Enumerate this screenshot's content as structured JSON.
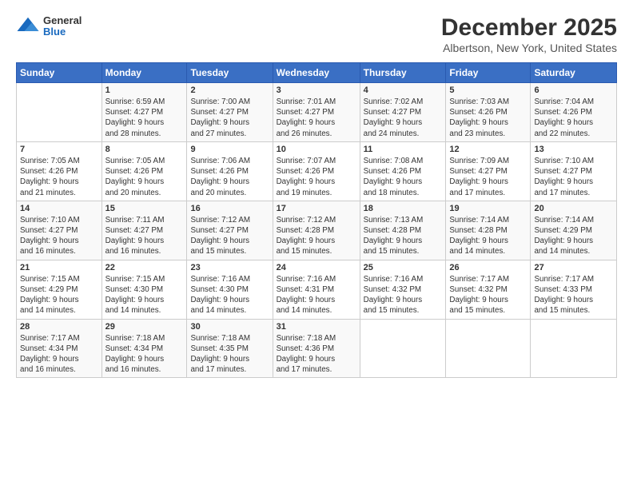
{
  "logo": {
    "general": "General",
    "blue": "Blue"
  },
  "header": {
    "title": "December 2025",
    "subtitle": "Albertson, New York, United States"
  },
  "calendar": {
    "days_of_week": [
      "Sunday",
      "Monday",
      "Tuesday",
      "Wednesday",
      "Thursday",
      "Friday",
      "Saturday"
    ],
    "weeks": [
      [
        {
          "day": "",
          "detail": ""
        },
        {
          "day": "1",
          "detail": "Sunrise: 6:59 AM\nSunset: 4:27 PM\nDaylight: 9 hours\nand 28 minutes."
        },
        {
          "day": "2",
          "detail": "Sunrise: 7:00 AM\nSunset: 4:27 PM\nDaylight: 9 hours\nand 27 minutes."
        },
        {
          "day": "3",
          "detail": "Sunrise: 7:01 AM\nSunset: 4:27 PM\nDaylight: 9 hours\nand 26 minutes."
        },
        {
          "day": "4",
          "detail": "Sunrise: 7:02 AM\nSunset: 4:27 PM\nDaylight: 9 hours\nand 24 minutes."
        },
        {
          "day": "5",
          "detail": "Sunrise: 7:03 AM\nSunset: 4:26 PM\nDaylight: 9 hours\nand 23 minutes."
        },
        {
          "day": "6",
          "detail": "Sunrise: 7:04 AM\nSunset: 4:26 PM\nDaylight: 9 hours\nand 22 minutes."
        }
      ],
      [
        {
          "day": "7",
          "detail": "Sunrise: 7:05 AM\nSunset: 4:26 PM\nDaylight: 9 hours\nand 21 minutes."
        },
        {
          "day": "8",
          "detail": "Sunrise: 7:05 AM\nSunset: 4:26 PM\nDaylight: 9 hours\nand 20 minutes."
        },
        {
          "day": "9",
          "detail": "Sunrise: 7:06 AM\nSunset: 4:26 PM\nDaylight: 9 hours\nand 20 minutes."
        },
        {
          "day": "10",
          "detail": "Sunrise: 7:07 AM\nSunset: 4:26 PM\nDaylight: 9 hours\nand 19 minutes."
        },
        {
          "day": "11",
          "detail": "Sunrise: 7:08 AM\nSunset: 4:26 PM\nDaylight: 9 hours\nand 18 minutes."
        },
        {
          "day": "12",
          "detail": "Sunrise: 7:09 AM\nSunset: 4:27 PM\nDaylight: 9 hours\nand 17 minutes."
        },
        {
          "day": "13",
          "detail": "Sunrise: 7:10 AM\nSunset: 4:27 PM\nDaylight: 9 hours\nand 17 minutes."
        }
      ],
      [
        {
          "day": "14",
          "detail": "Sunrise: 7:10 AM\nSunset: 4:27 PM\nDaylight: 9 hours\nand 16 minutes."
        },
        {
          "day": "15",
          "detail": "Sunrise: 7:11 AM\nSunset: 4:27 PM\nDaylight: 9 hours\nand 16 minutes."
        },
        {
          "day": "16",
          "detail": "Sunrise: 7:12 AM\nSunset: 4:27 PM\nDaylight: 9 hours\nand 15 minutes."
        },
        {
          "day": "17",
          "detail": "Sunrise: 7:12 AM\nSunset: 4:28 PM\nDaylight: 9 hours\nand 15 minutes."
        },
        {
          "day": "18",
          "detail": "Sunrise: 7:13 AM\nSunset: 4:28 PM\nDaylight: 9 hours\nand 15 minutes."
        },
        {
          "day": "19",
          "detail": "Sunrise: 7:14 AM\nSunset: 4:28 PM\nDaylight: 9 hours\nand 14 minutes."
        },
        {
          "day": "20",
          "detail": "Sunrise: 7:14 AM\nSunset: 4:29 PM\nDaylight: 9 hours\nand 14 minutes."
        }
      ],
      [
        {
          "day": "21",
          "detail": "Sunrise: 7:15 AM\nSunset: 4:29 PM\nDaylight: 9 hours\nand 14 minutes."
        },
        {
          "day": "22",
          "detail": "Sunrise: 7:15 AM\nSunset: 4:30 PM\nDaylight: 9 hours\nand 14 minutes."
        },
        {
          "day": "23",
          "detail": "Sunrise: 7:16 AM\nSunset: 4:30 PM\nDaylight: 9 hours\nand 14 minutes."
        },
        {
          "day": "24",
          "detail": "Sunrise: 7:16 AM\nSunset: 4:31 PM\nDaylight: 9 hours\nand 14 minutes."
        },
        {
          "day": "25",
          "detail": "Sunrise: 7:16 AM\nSunset: 4:32 PM\nDaylight: 9 hours\nand 15 minutes."
        },
        {
          "day": "26",
          "detail": "Sunrise: 7:17 AM\nSunset: 4:32 PM\nDaylight: 9 hours\nand 15 minutes."
        },
        {
          "day": "27",
          "detail": "Sunrise: 7:17 AM\nSunset: 4:33 PM\nDaylight: 9 hours\nand 15 minutes."
        }
      ],
      [
        {
          "day": "28",
          "detail": "Sunrise: 7:17 AM\nSunset: 4:34 PM\nDaylight: 9 hours\nand 16 minutes."
        },
        {
          "day": "29",
          "detail": "Sunrise: 7:18 AM\nSunset: 4:34 PM\nDaylight: 9 hours\nand 16 minutes."
        },
        {
          "day": "30",
          "detail": "Sunrise: 7:18 AM\nSunset: 4:35 PM\nDaylight: 9 hours\nand 17 minutes."
        },
        {
          "day": "31",
          "detail": "Sunrise: 7:18 AM\nSunset: 4:36 PM\nDaylight: 9 hours\nand 17 minutes."
        },
        {
          "day": "",
          "detail": ""
        },
        {
          "day": "",
          "detail": ""
        },
        {
          "day": "",
          "detail": ""
        }
      ]
    ]
  }
}
